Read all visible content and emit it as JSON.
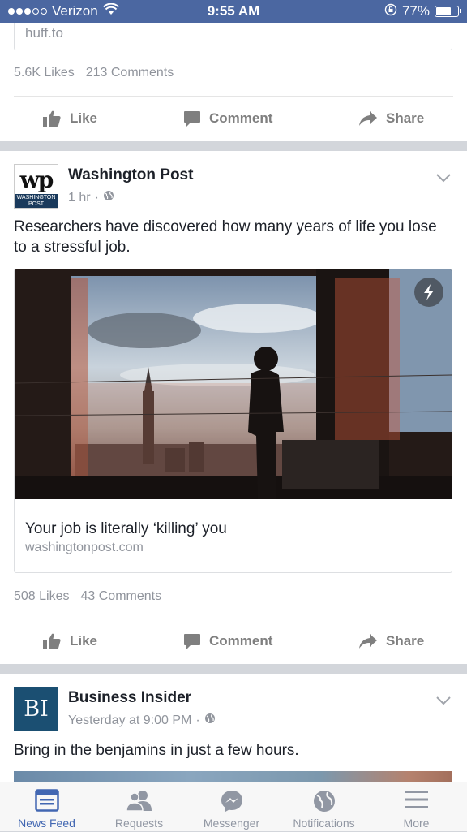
{
  "status_bar": {
    "carrier": "Verizon",
    "time": "9:55 AM",
    "battery": "77%",
    "battery_level": 0.77,
    "signal_bars_filled": 3,
    "signal_bars_total": 5
  },
  "posts": [
    {
      "link_domain": "huff.to",
      "likes": "5.6K Likes",
      "comments": "213 Comments",
      "actions": {
        "like": "Like",
        "comment": "Comment",
        "share": "Share"
      }
    },
    {
      "page_name": "Washington Post",
      "avatar_text": "WASHINGTON POST",
      "time": "1 hr",
      "separator": "·",
      "text": "Researchers have discovered how many years of life you lose to a stressful job.",
      "link": {
        "title": "Your job is literally ‘killing’ you",
        "domain": "washingtonpost.com"
      },
      "likes": "508 Likes",
      "comments": "43 Comments",
      "actions": {
        "like": "Like",
        "comment": "Comment",
        "share": "Share"
      }
    },
    {
      "page_name": "Business Insider",
      "avatar_text": "BI",
      "time": "Yesterday at 9:00 PM",
      "separator": "·",
      "text": "Bring in the benjamins in just a few hours."
    }
  ],
  "tabbar": [
    {
      "label": "News Feed",
      "icon": "news-feed-icon",
      "active": true
    },
    {
      "label": "Requests",
      "icon": "friends-icon",
      "active": false
    },
    {
      "label": "Messenger",
      "icon": "messenger-icon",
      "active": false
    },
    {
      "label": "Notifications",
      "icon": "globe-icon",
      "active": false
    },
    {
      "label": "More",
      "icon": "menu-icon",
      "active": false
    }
  ],
  "colors": {
    "status_bar": "#4b67a1",
    "active_tab": "#4267b2",
    "inactive_tab": "#9197a3",
    "secondary_text": "#90949c"
  }
}
